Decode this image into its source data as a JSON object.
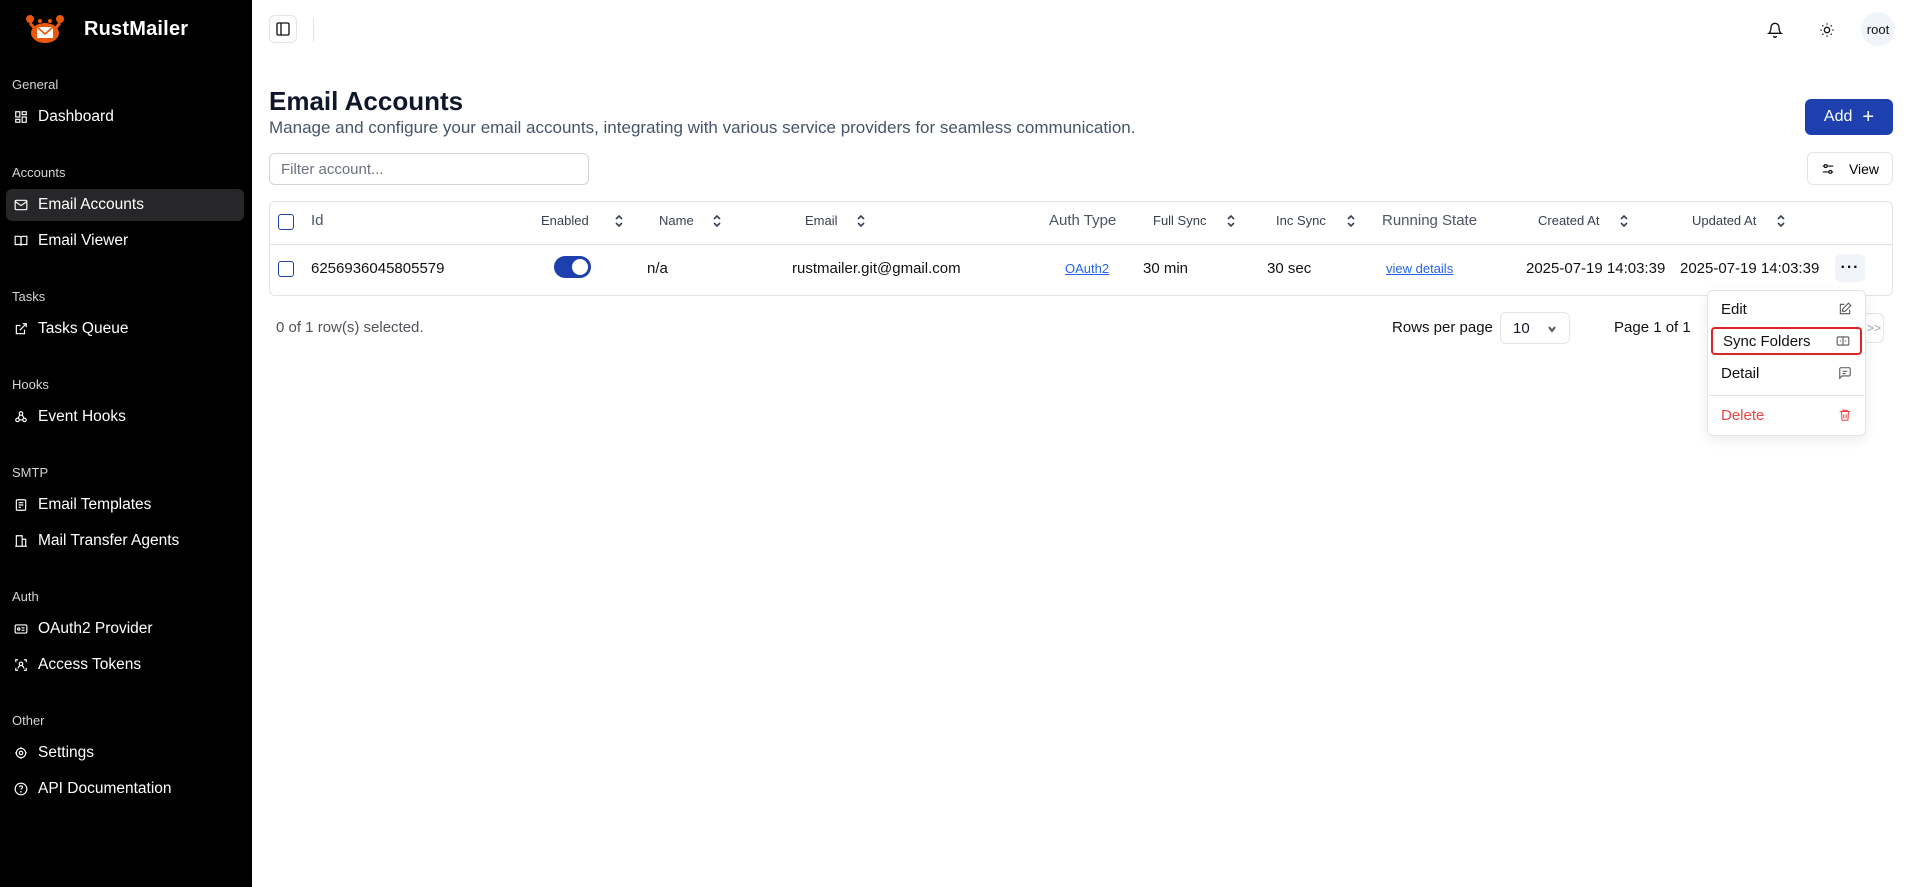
{
  "app": {
    "name": "RustMailer"
  },
  "sidebar": {
    "groups": [
      {
        "label": "General",
        "items": [
          {
            "label": "Dashboard",
            "icon": "dashboard-icon"
          }
        ]
      },
      {
        "label": "Accounts",
        "items": [
          {
            "label": "Email Accounts",
            "icon": "mail-icon",
            "active": true
          },
          {
            "label": "Email Viewer",
            "icon": "book-open-icon"
          }
        ]
      },
      {
        "label": "Tasks",
        "items": [
          {
            "label": "Tasks Queue",
            "icon": "external-link-icon"
          }
        ]
      },
      {
        "label": "Hooks",
        "items": [
          {
            "label": "Event Hooks",
            "icon": "webhook-icon"
          }
        ]
      },
      {
        "label": "SMTP",
        "items": [
          {
            "label": "Email Templates",
            "icon": "template-icon"
          },
          {
            "label": "Mail Transfer Agents",
            "icon": "building-icon"
          }
        ]
      },
      {
        "label": "Auth",
        "items": [
          {
            "label": "OAuth2 Provider",
            "icon": "id-card-icon"
          },
          {
            "label": "Access Tokens",
            "icon": "scan-face-icon"
          }
        ]
      },
      {
        "label": "Other",
        "items": [
          {
            "label": "Settings",
            "icon": "gear-icon"
          },
          {
            "label": "API Documentation",
            "icon": "help-circle-icon"
          }
        ]
      }
    ]
  },
  "header": {
    "user": "root"
  },
  "page": {
    "title": "Email Accounts",
    "description": "Manage and configure your email accounts, integrating with various service providers for seamless communication.",
    "add_label": "Add",
    "filter_placeholder": "Filter account...",
    "view_label": "View"
  },
  "table": {
    "columns": {
      "id": "Id",
      "enabled": "Enabled",
      "name": "Name",
      "email": "Email",
      "auth_type": "Auth Type",
      "full_sync": "Full Sync",
      "inc_sync": "Inc Sync",
      "running_state": "Running State",
      "created_at": "Created At",
      "updated_at": "Updated At"
    },
    "rows": [
      {
        "id": "6256936045805579",
        "enabled": true,
        "name": "n/a",
        "email": "rustmailer.git@gmail.com",
        "auth_type": "OAuth2",
        "full_sync": "30 min",
        "inc_sync": "30 sec",
        "running_state": "view details",
        "created_at": "2025-07-19 14:03:39",
        "updated_at": "2025-07-19 14:03:39",
        "actions": "···"
      }
    ]
  },
  "footer": {
    "selected": "0 of 1 row(s) selected.",
    "rows_per_page_label": "Rows per page",
    "rows_per_page": "10",
    "page_info": "Page 1 of 1",
    "next": ">>"
  },
  "menu": {
    "edit": "Edit",
    "sync_folders": "Sync Folders",
    "detail": "Detail",
    "delete": "Delete"
  },
  "colors": {
    "accent": "#1e40af",
    "danger": "#ef4444",
    "highlight": "#dc2626"
  }
}
